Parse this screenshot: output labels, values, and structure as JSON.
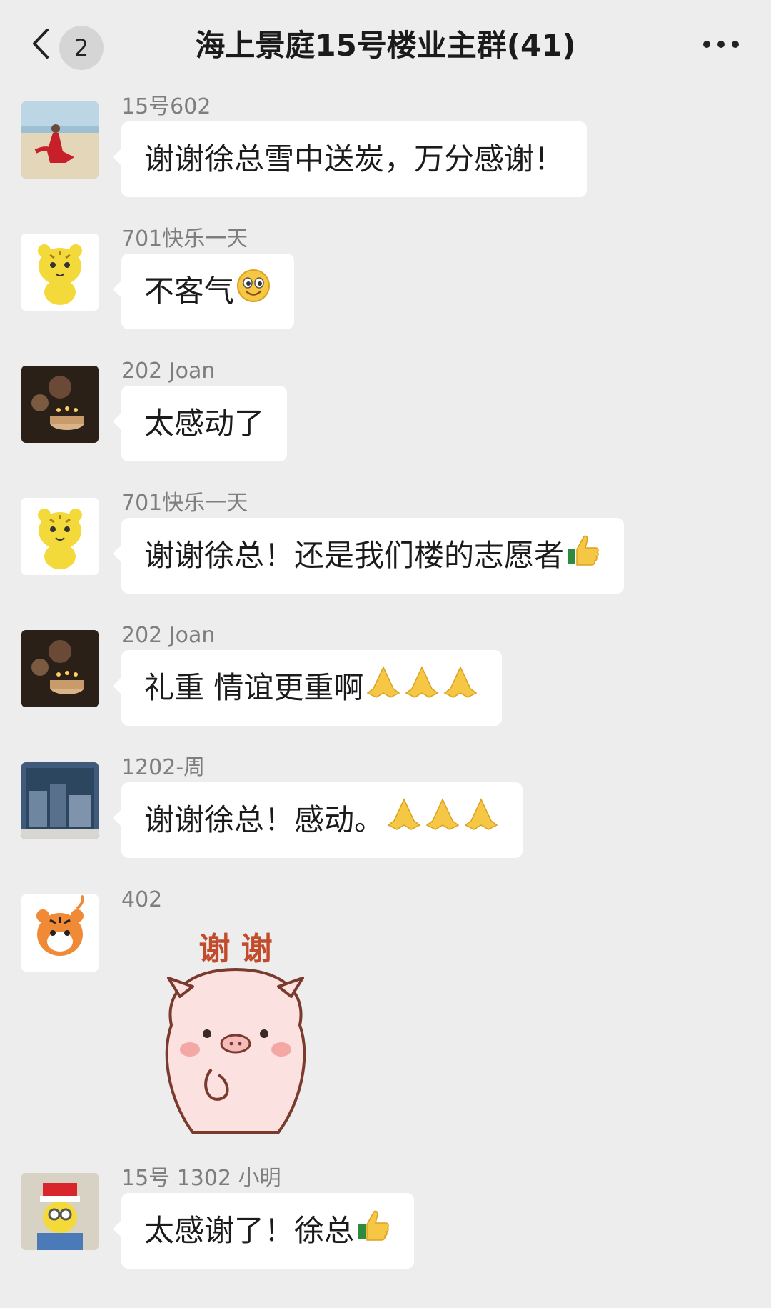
{
  "header": {
    "back_label": "返回",
    "unread_count": "2",
    "title": "海上景庭15号楼业主群(41)"
  },
  "messages": [
    {
      "sender": "15号602",
      "text": "谢谢徐总雪中送炭，万分感谢！"
    },
    {
      "sender": "701快乐一天",
      "text": "不客气",
      "emoji": "smile-emoji"
    },
    {
      "sender": "202 Joan",
      "text": "太感动了"
    },
    {
      "sender": "701快乐一天",
      "text": "谢谢徐总！还是我们楼的志愿者",
      "emoji": "thumbs-up-emoji"
    },
    {
      "sender": "202 Joan",
      "text": "礼重 情谊更重啊",
      "emoji": "pray-emoji x3"
    },
    {
      "sender": "1202-周",
      "text": "谢谢徐总！感动。",
      "emoji": "pray-emoji x3"
    },
    {
      "sender": "402",
      "sticker_text": "谢 谢",
      "sticker": "pig-thanks-sticker"
    },
    {
      "sender": "15号 1302 小明",
      "text": "太感谢了！徐总",
      "emoji": "thumbs-up-emoji"
    }
  ],
  "colors": {
    "background": "#ededed",
    "bubble": "#ffffff",
    "sender_text": "#7e7e7e",
    "message_text": "#1b1b1b"
  }
}
